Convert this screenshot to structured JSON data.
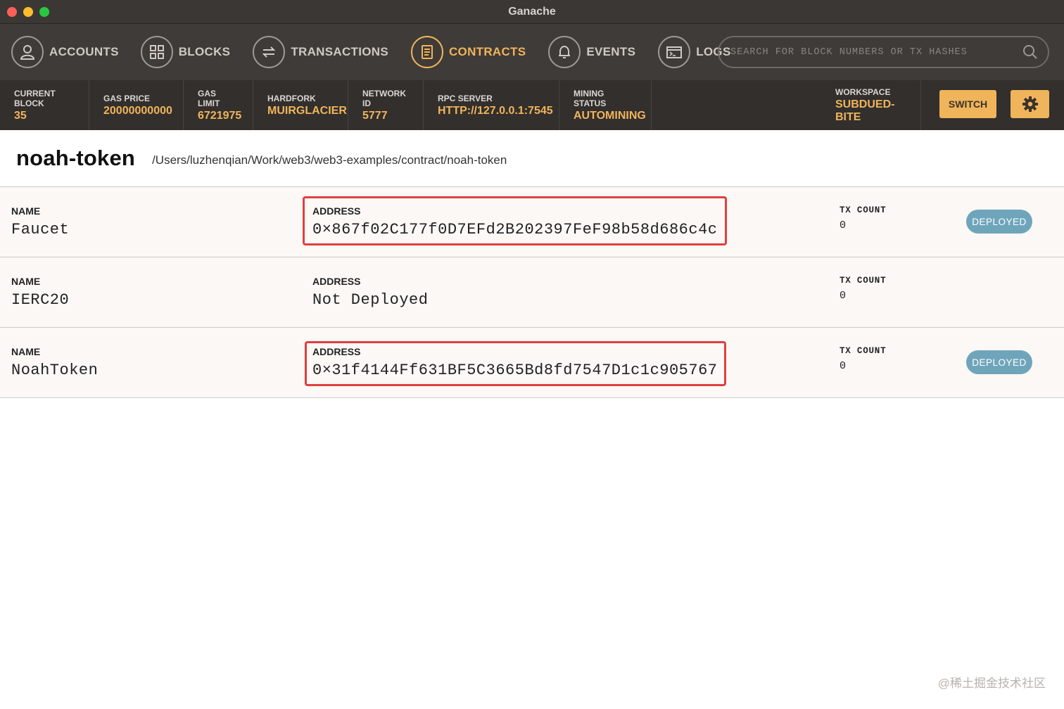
{
  "window": {
    "title": "Ganache"
  },
  "nav": {
    "items": [
      {
        "label": "ACCOUNTS",
        "icon": "user-icon"
      },
      {
        "label": "BLOCKS",
        "icon": "blocks-icon"
      },
      {
        "label": "TRANSACTIONS",
        "icon": "transfer-icon"
      },
      {
        "label": "CONTRACTS",
        "icon": "document-icon",
        "active": true
      },
      {
        "label": "EVENTS",
        "icon": "bell-icon"
      },
      {
        "label": "LOGS",
        "icon": "terminal-icon"
      }
    ],
    "search_placeholder": "SEARCH FOR BLOCK NUMBERS OR TX HASHES"
  },
  "status": {
    "current_block": {
      "label": "CURRENT BLOCK",
      "value": "35"
    },
    "gas_price": {
      "label": "GAS PRICE",
      "value": "20000000000"
    },
    "gas_limit": {
      "label": "GAS LIMIT",
      "value": "6721975"
    },
    "hardfork": {
      "label": "HARDFORK",
      "value": "MUIRGLACIER"
    },
    "network_id": {
      "label": "NETWORK ID",
      "value": "5777"
    },
    "rpc_server": {
      "label": "RPC SERVER",
      "value": "HTTP://127.0.0.1:7545"
    },
    "mining_status": {
      "label": "MINING STATUS",
      "value": "AUTOMINING"
    },
    "workspace": {
      "label": "WORKSPACE",
      "value": "SUBDUED-BITE"
    },
    "switch_label": "SWITCH"
  },
  "project": {
    "name": "noah-token",
    "path": "/Users/luzhenqian/Work/web3/web3-examples/contract/noah-token"
  },
  "contracts": [
    {
      "name_label": "NAME",
      "name": "Faucet",
      "address_label": "ADDRESS",
      "address": "0×867f02C177f0D7EFd2B202397FeF98b58d686c4c",
      "tx_label": "TX COUNT",
      "tx_count": "0",
      "badge": "DEPLOYED"
    },
    {
      "name_label": "NAME",
      "name": "IERC20",
      "address_label": "ADDRESS",
      "address": "Not Deployed",
      "tx_label": "TX COUNT",
      "tx_count": "0",
      "badge": ""
    },
    {
      "name_label": "NAME",
      "name": "NoahToken",
      "address_label": "ADDRESS",
      "address": "0×31f4144Ff631BF5C3665Bd8fd7547D1c1c905767",
      "tx_label": "TX COUNT",
      "tx_count": "0",
      "badge": "DEPLOYED"
    }
  ],
  "watermark": "@稀土掘金技术社区",
  "colors": {
    "accent": "#f0b45b",
    "badge": "#6fa5bb",
    "highlight": "#e03f3f"
  }
}
